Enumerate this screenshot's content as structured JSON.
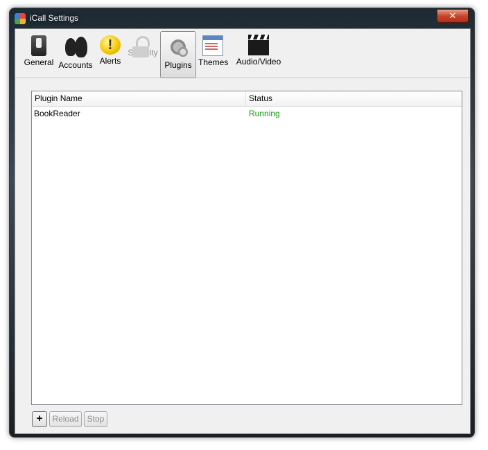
{
  "window": {
    "title": "iCall Settings",
    "close_label": "✕"
  },
  "toolbar": {
    "items": [
      {
        "label": "General",
        "icon": "switch-icon",
        "state": "normal"
      },
      {
        "label": "Accounts",
        "icon": "people-icon",
        "state": "normal"
      },
      {
        "label": "Alerts",
        "icon": "exclamation-icon",
        "state": "normal"
      },
      {
        "label": "Security",
        "icon": "lock-icon",
        "state": "disabled"
      },
      {
        "label": "Plugins",
        "icon": "gears-icon",
        "state": "selected"
      },
      {
        "label": "Themes",
        "icon": "window-theme-icon",
        "state": "normal"
      },
      {
        "label": "Audio/Video",
        "icon": "clapperboard-icon",
        "state": "normal"
      }
    ],
    "alerts_glyph": "!"
  },
  "plugins": {
    "columns": [
      "Plugin Name",
      "Status"
    ],
    "rows": [
      {
        "name": "BookReader",
        "status": "Running"
      }
    ],
    "status_color": "#17950f"
  },
  "actions": {
    "add_label": "+",
    "reload_label": "Reload",
    "stop_label": "Stop"
  }
}
